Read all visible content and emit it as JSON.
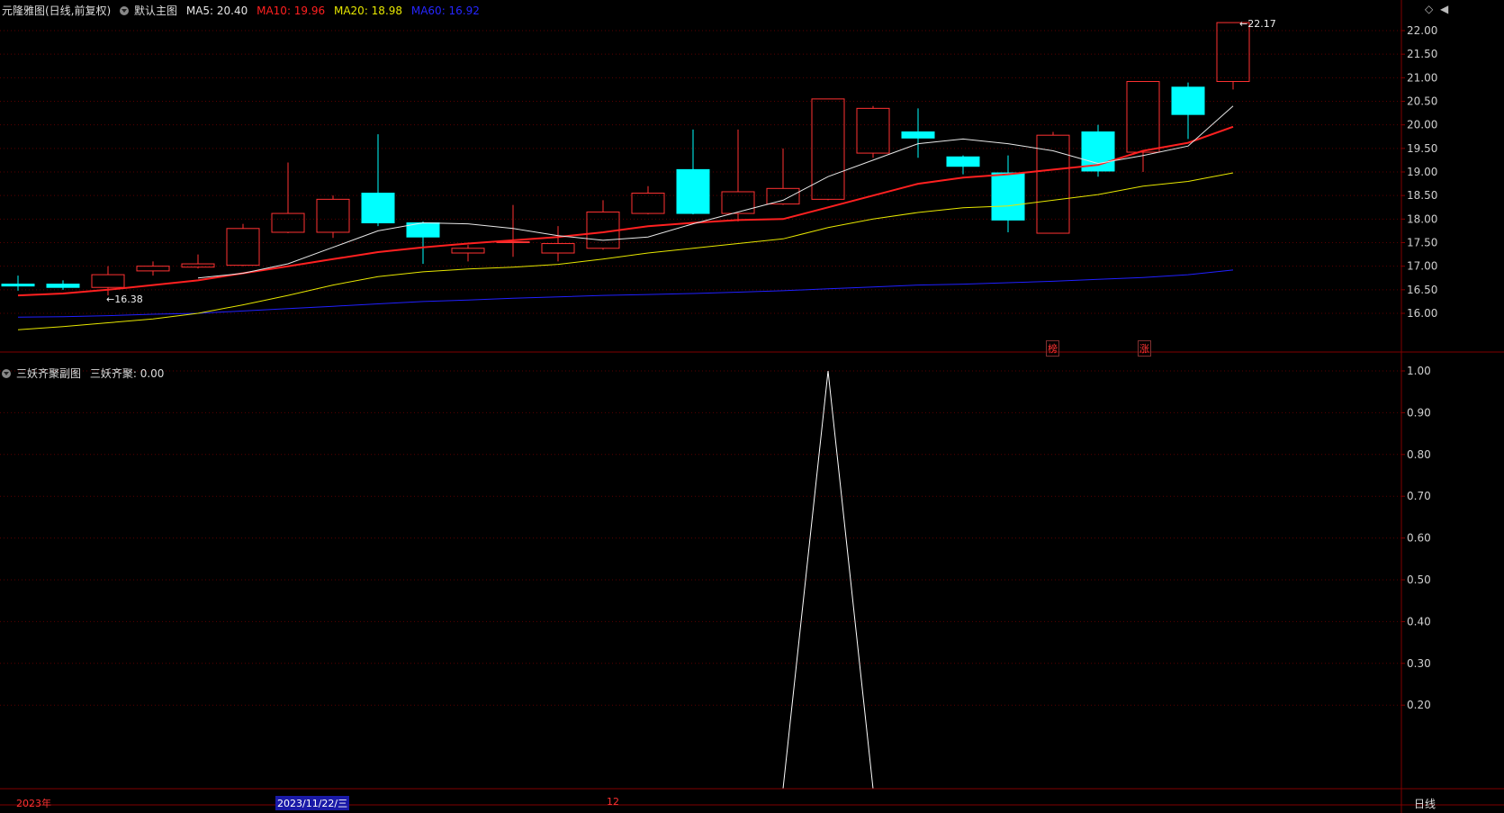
{
  "main_header": {
    "title": "元隆雅图(日线,前复权)",
    "template": "默认主图",
    "ma5": "MA5: 20.40",
    "ma10": "MA10: 19.96",
    "ma20": "MA20: 18.98",
    "ma60": "MA60: 16.92"
  },
  "sub_header": {
    "title": "三妖齐聚副图",
    "value": "三妖齐聚: 0.00"
  },
  "corner_icons": [
    "diamond-icon",
    "collapse-icon"
  ],
  "annotations": {
    "high_label": "22.17",
    "low_label": "16.38"
  },
  "markers": [
    "榜",
    "涨"
  ],
  "bottom_bar": {
    "year_label": "2023年",
    "cursor_date": "2023/11/22/三",
    "month_label": "12",
    "period": "日线"
  },
  "colors": {
    "up": "#ff3232",
    "down": "#00ffff",
    "ma5": "#e6e6e6",
    "ma10": "#ff2020",
    "ma20": "#e6e600",
    "ma60": "#2020ff",
    "axis": "#800000",
    "subline": "#ffffff"
  },
  "chart_data": [
    {
      "type": "candlestick",
      "title": "元隆雅图(日线,前复权)",
      "y_ticks": [
        "22.00",
        "21.50",
        "21.00",
        "20.50",
        "20.00",
        "19.50",
        "19.00",
        "18.50",
        "18.00",
        "17.50",
        "17.00",
        "16.50",
        "16.00"
      ],
      "ylim": [
        15.5,
        22.2
      ],
      "candles": [
        {
          "o": 16.62,
          "c": 16.58,
          "h": 16.8,
          "l": 16.48
        },
        {
          "o": 16.62,
          "c": 16.55,
          "h": 16.7,
          "l": 16.5
        },
        {
          "o": 16.55,
          "c": 16.82,
          "h": 17.0,
          "l": 16.38
        },
        {
          "o": 16.9,
          "c": 17.0,
          "h": 17.1,
          "l": 16.8
        },
        {
          "o": 16.98,
          "c": 17.05,
          "h": 17.25,
          "l": 16.95
        },
        {
          "o": 17.02,
          "c": 17.8,
          "h": 17.9,
          "l": 17.0
        },
        {
          "o": 17.72,
          "c": 18.12,
          "h": 19.2,
          "l": 17.7
        },
        {
          "o": 17.72,
          "c": 18.42,
          "h": 18.5,
          "l": 17.6
        },
        {
          "o": 18.55,
          "c": 17.92,
          "h": 19.8,
          "l": 17.85
        },
        {
          "o": 17.92,
          "c": 17.62,
          "h": 17.95,
          "l": 17.05
        },
        {
          "o": 17.28,
          "c": 17.38,
          "h": 17.45,
          "l": 17.1
        },
        {
          "o": 17.5,
          "c": 17.52,
          "h": 18.3,
          "l": 17.2
        },
        {
          "o": 17.28,
          "c": 17.48,
          "h": 17.85,
          "l": 17.1
        },
        {
          "o": 17.38,
          "c": 18.15,
          "h": 18.4,
          "l": 17.35
        },
        {
          "o": 18.12,
          "c": 18.55,
          "h": 18.7,
          "l": 18.1
        },
        {
          "o": 19.05,
          "c": 18.12,
          "h": 19.9,
          "l": 18.1
        },
        {
          "o": 18.12,
          "c": 18.58,
          "h": 19.9,
          "l": 17.95
        },
        {
          "o": 18.32,
          "c": 18.65,
          "h": 19.5,
          "l": 18.3
        },
        {
          "o": 18.42,
          "c": 20.55,
          "h": 20.55,
          "l": 18.4
        },
        {
          "o": 19.4,
          "c": 20.35,
          "h": 20.4,
          "l": 19.3
        },
        {
          "o": 19.85,
          "c": 19.72,
          "h": 20.35,
          "l": 19.3
        },
        {
          "o": 19.32,
          "c": 19.12,
          "h": 19.35,
          "l": 18.95
        },
        {
          "o": 18.98,
          "c": 17.98,
          "h": 19.35,
          "l": 17.72
        },
        {
          "o": 17.7,
          "c": 19.78,
          "h": 19.85,
          "l": 17.7
        },
        {
          "o": 19.85,
          "c": 19.02,
          "h": 20.0,
          "l": 18.9
        },
        {
          "o": 19.42,
          "c": 20.92,
          "h": 20.92,
          "l": 19.0
        },
        {
          "o": 20.8,
          "c": 20.22,
          "h": 20.9,
          "l": 19.7
        },
        {
          "o": 20.92,
          "c": 22.17,
          "h": 22.17,
          "l": 20.75
        }
      ],
      "ma5": [
        null,
        null,
        null,
        null,
        16.75,
        16.85,
        17.05,
        17.4,
        17.75,
        17.92,
        17.9,
        17.8,
        17.65,
        17.55,
        17.62,
        17.9,
        18.15,
        18.4,
        18.9,
        19.25,
        19.6,
        19.7,
        19.6,
        19.45,
        19.18,
        19.35,
        19.55,
        20.4
      ],
      "ma10": [
        16.38,
        16.42,
        16.5,
        16.6,
        16.7,
        16.85,
        17.0,
        17.15,
        17.3,
        17.4,
        17.48,
        17.55,
        17.62,
        17.72,
        17.85,
        17.92,
        17.98,
        18.0,
        18.25,
        18.5,
        18.75,
        18.88,
        18.95,
        19.05,
        19.15,
        19.45,
        19.62,
        19.96
      ],
      "ma20": [
        15.65,
        15.72,
        15.8,
        15.88,
        16.0,
        16.18,
        16.38,
        16.6,
        16.78,
        16.88,
        16.94,
        16.98,
        17.04,
        17.15,
        17.28,
        17.38,
        17.48,
        17.58,
        17.82,
        18.0,
        18.14,
        18.24,
        18.28,
        18.4,
        18.52,
        18.7,
        18.8,
        18.98
      ],
      "ma60": [
        15.92,
        15.93,
        15.95,
        15.98,
        16.0,
        16.05,
        16.1,
        16.15,
        16.2,
        16.25,
        16.28,
        16.32,
        16.35,
        16.38,
        16.4,
        16.42,
        16.45,
        16.48,
        16.52,
        16.56,
        16.6,
        16.62,
        16.65,
        16.68,
        16.72,
        16.76,
        16.82,
        16.92
      ]
    },
    {
      "type": "line",
      "title": "三妖齐聚副图",
      "series": [
        {
          "name": "三妖齐聚",
          "values": [
            0,
            0,
            0,
            0,
            0,
            0,
            0,
            0,
            0,
            0,
            0,
            0,
            0,
            0,
            0,
            0,
            0,
            0,
            1,
            0,
            0,
            0,
            0,
            0,
            0,
            0,
            0,
            0
          ]
        }
      ],
      "y_ticks": [
        "1.00",
        "0.90",
        "0.80",
        "0.70",
        "0.60",
        "0.50",
        "0.40",
        "0.30",
        "0.20"
      ],
      "ylim": [
        0,
        1
      ]
    }
  ]
}
